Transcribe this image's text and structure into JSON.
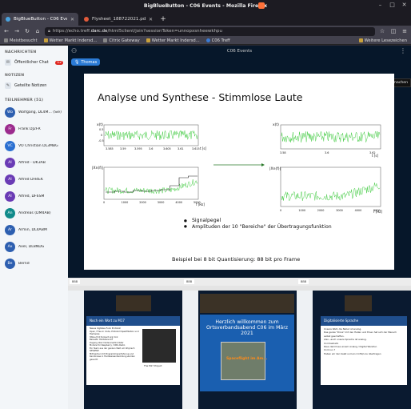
{
  "window": {
    "title": "BigBlueButton - C06 Events - Mozilla Firefox"
  },
  "tabs": [
    {
      "label": "BigBlueButton - C06 Eve",
      "active": true
    },
    {
      "label": "Flysheet_188722021.pdf",
      "active": false
    }
  ],
  "nav": {
    "url_prefix": "https://echo.treff.",
    "url_domain": "darc.de",
    "url_suffix": "/html5client/join?sessionToken=unnopxsnheewkhpu"
  },
  "bookmarks": [
    "Meistbesucht",
    "Wetter Markt Indersd...",
    "Citrix Gateway",
    "Wetter Markt Indersd...",
    "C06 Treff"
  ],
  "bookmarks_right": "Weitere Lesezeichen",
  "sidebar": {
    "section_messages": "NACHRICHTEN",
    "public_chat": "Öffentlicher Chat",
    "public_chat_count": "12",
    "section_notes": "NOTIZEN",
    "shared_notes": "Geteilte Notizen",
    "section_participants": "TEILNEHMER (51)",
    "users": [
      {
        "initials": "Wo",
        "name": "Wolfgang, DL4M... (Sie)",
        "color": "#2d5fb0"
      },
      {
        "initials": "Fr",
        "name": "Frank DJ2FR",
        "color": "#9c2b8e"
      },
      {
        "initials": "VC",
        "name": "VO Christian DL3MBG",
        "color": "#2a6fd1"
      },
      {
        "initials": "Al",
        "name": "Alfred - DK3AB",
        "color": "#6a3bb5"
      },
      {
        "initials": "Al",
        "name": "Alfred DH4EK",
        "color": "#6a3bb5"
      },
      {
        "initials": "Al",
        "name": "Alfred, DF6SM",
        "color": "#6a3bb5"
      },
      {
        "initials": "An",
        "name": "Andreas (DM4AB)",
        "color": "#0f8a8a"
      },
      {
        "initials": "Ar",
        "name": "Armin, DL4ABM",
        "color": "#2d5fb0"
      },
      {
        "initials": "Ax",
        "name": "Axel, DL8NDG",
        "color": "#2d5fb0"
      },
      {
        "initials": "Be",
        "name": "Bernd",
        "color": "#2d5fb0"
      }
    ]
  },
  "main": {
    "room_title": "C06 Events",
    "talking_user": "Thomas",
    "tooltip": "Bildschirmfreigabe zum Vollbild machen"
  },
  "slide": {
    "title": "Analyse und Synthese - Stimmlose Laute",
    "bullets": [
      "Signalpegel",
      "Amplituden der 10 \"Bereiche\" der Übertragungsfunktion"
    ],
    "footer": "Beispiel bei 8 bit Quantisierung: 88 bit pro Frame",
    "plot_labels": {
      "ylabel_time": "x(t)",
      "xlabel_time": "t [s]",
      "ylabel_freq": "|Xn(f)|",
      "xlabel_freq": "f [Hz]",
      "time_ticks": [
        "3.585",
        "3.59",
        "3.595",
        "3.6",
        "3.605",
        "3.61",
        "3.615"
      ],
      "time_yticks": [
        "0.5",
        "0",
        "-0.5"
      ],
      "freq_ticks": [
        "0",
        "1000",
        "2000",
        "3000",
        "4000",
        "5000"
      ],
      "right_time_ticks": [
        "3.58",
        "3.6",
        "3.62"
      ],
      "right_freq_ticks": [
        "0",
        "1000",
        "2000",
        "3000",
        "4000",
        "5000"
      ]
    }
  },
  "thumbnails": [
    {
      "slide_title": "Noch ein Wort zu M17",
      "lines": [
        "Neues digitales Funk Protokoll",
        "Open / Free in Code, Protokoll Spezifikation und Hardware",
        "https://m17project.org/ link",
        "Bausatz: Hardware Kit",
        "Zugang über Dadevice/Droidstar",
        "Module für Raspberry / ORU-Radio",
        "Ein Team aus der ganzen Welt um Wojciech SP5WWP",
        "Mitmacher mit Programmiererfahrung und Kenntnisse in Hardwareentwicklung werden gesucht"
      ],
      "caption": "The M17 Project"
    },
    {
      "slide_title": "Herzlich willkommen zum Ortsverbandsabend C06 im März 2021",
      "overlay": "Spaceflight im Am..."
    },
    {
      "slide_title": "Digitalisierte Sprache",
      "lines": [
        "Unsere Welt, die Natur ist analog.",
        "Das ganze \"Drive\" mit den Hallen und Einen hat sich der Mensch selbst geschaffen.",
        "Also...auch unsere Sprache ist analog.",
        "Und deshalb:",
        "Raus damit aus einem Analog / Digital Wandler.",
        "Und nun ?",
        "Haben wir den Salat und ein 4 kHz/s zu übertragen"
      ]
    }
  ]
}
